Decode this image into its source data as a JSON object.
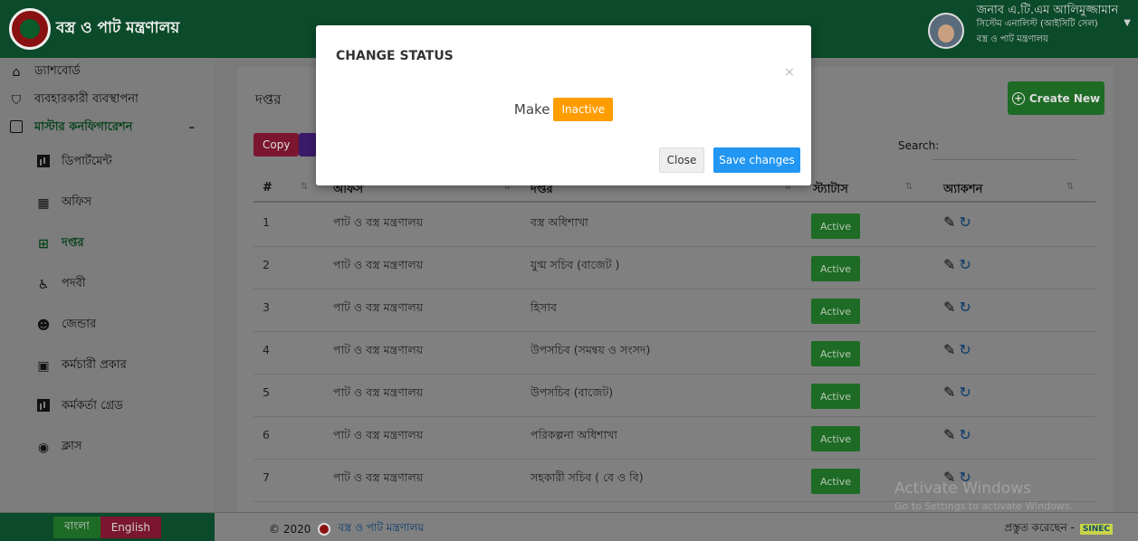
{
  "header": {
    "brand_title": "বস্ত্র ও পাট মন্ত্রণালয়",
    "user_name": "জনাব এ.টি.এম আলিমুজ্জামান",
    "user_role": "সিস্টেম এনালিস্ট (আইসিটি সেল)",
    "user_org": "বস্ত্র ও পাট মন্ত্রণালয়"
  },
  "sidebar": {
    "items": [
      {
        "label": "ড্যাশবোর্ড",
        "icon": "home-icon"
      },
      {
        "label": "ব্যবহারকারী ব্যবস্থাপনা",
        "icon": "shield-icon"
      },
      {
        "label": "মাস্টার কনফিগারেশন",
        "icon": "box-icon",
        "toggle": "–"
      },
      {
        "label": "ডিপার্টমেন্ট",
        "icon": "chart-icon"
      },
      {
        "label": "অফিস",
        "icon": "building-icon"
      },
      {
        "label": "দপ্তর",
        "icon": "grid-icon"
      },
      {
        "label": "পদবী",
        "icon": "accessible-icon"
      },
      {
        "label": "জেন্ডার",
        "icon": "users-icon"
      },
      {
        "label": "কর্মচারী প্রকার",
        "icon": "badge-icon"
      },
      {
        "label": "কর্মকর্তা গ্রেড",
        "icon": "chart-icon"
      },
      {
        "label": "ক্লাস",
        "icon": "user-circle-icon"
      }
    ]
  },
  "panel": {
    "title": "দপ্তর",
    "create_label": "Create New",
    "copy_label": "Copy",
    "search_label": "Search:"
  },
  "table": {
    "headers": [
      "#",
      "অফিস",
      "দপ্তর",
      "স্ট্যাটাস",
      "অ্যাকশন"
    ],
    "rows": [
      {
        "no": "1",
        "office": "পাট ও বস্ত্র মন্ত্রণালয়",
        "dept": "বস্ত্র অধিশাখা",
        "status": "Active"
      },
      {
        "no": "2",
        "office": "পাট ও বস্ত্র মন্ত্রণালয়",
        "dept": "যুগ্ম সচিব (বাজেট )",
        "status": "Active"
      },
      {
        "no": "3",
        "office": "পাট ও বস্ত্র মন্ত্রণালয়",
        "dept": "হিসাব",
        "status": "Active"
      },
      {
        "no": "4",
        "office": "পাট ও বস্ত্র মন্ত্রণালয়",
        "dept": "উপসচিব (সমন্বয় ও সংসদ)",
        "status": "Active"
      },
      {
        "no": "5",
        "office": "পাট ও বস্ত্র মন্ত্রণালয়",
        "dept": "উপসচিব (বাজেট)",
        "status": "Active"
      },
      {
        "no": "6",
        "office": "পাট ও বস্ত্র মন্ত্রণালয়",
        "dept": "পরিকল্পনা অধিশাখা",
        "status": "Active"
      },
      {
        "no": "7",
        "office": "পাট ও বস্ত্র মন্ত্রণালয়",
        "dept": "সহকারী সচিব ( বে ও বি)",
        "status": "Active"
      }
    ]
  },
  "modal": {
    "title": "CHANGE STATUS",
    "make_label": "Make",
    "status_button": "Inactive",
    "close_label": "Close",
    "save_label": "Save changes",
    "close_icon": "×"
  },
  "watermark": {
    "line1": "Activate Windows",
    "line2": "Go to Settings to activate Windows."
  },
  "footer": {
    "lang_bn": "বাংলা",
    "lang_en": "English",
    "copyright": "© 2020",
    "org": "বস্ত্র ও পাট মন্ত্রণালয়",
    "credit": "প্রস্তুত করেছেন -",
    "credit_brand": "SINEC"
  }
}
